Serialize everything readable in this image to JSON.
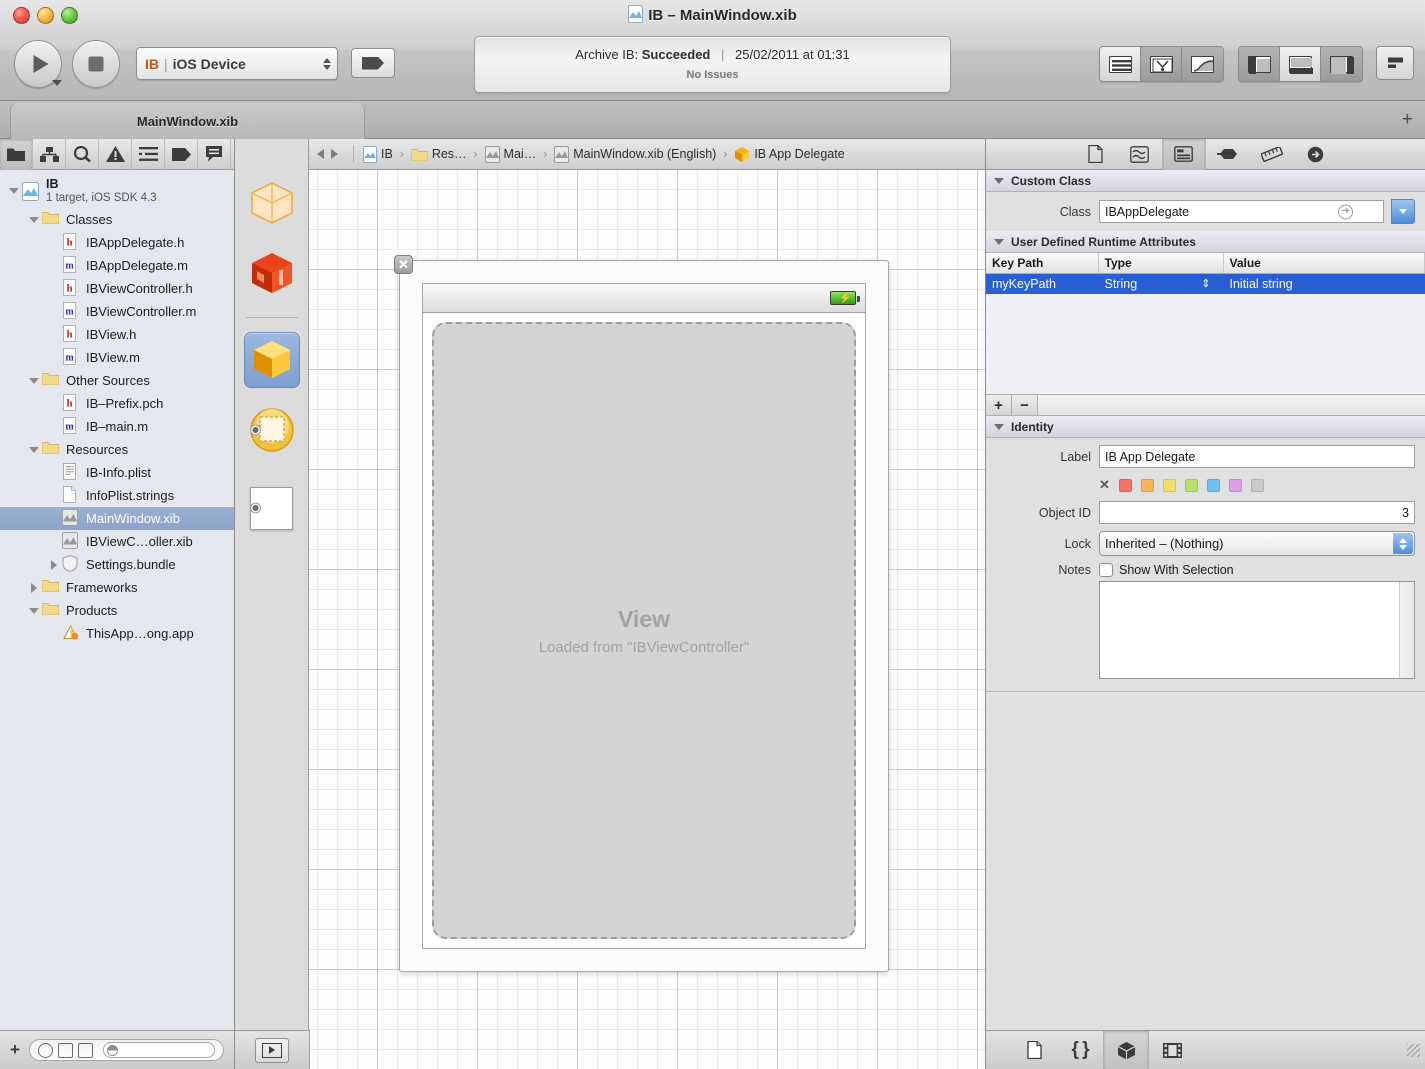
{
  "window": {
    "title": "IB – MainWindow.xib",
    "title_icon": "xib-file-icon",
    "controls": [
      "close",
      "minimize",
      "zoom"
    ]
  },
  "toolbar": {
    "run_button": "run-button",
    "stop_button": "stop-button",
    "scheme": {
      "scheme_name": "IB",
      "separator": "|",
      "destination": "iOS Device"
    },
    "breakpoints_button": "breakpoints-button",
    "status": {
      "line1_prefix": "Archive IB:",
      "line1_result": "Succeeded",
      "line1_divider": "|",
      "line1_date": "25/02/2011 at 01:31",
      "line2": "No Issues"
    },
    "editor_buttons": [
      "standard-editor",
      "assistant-editor",
      "version-editor"
    ],
    "view_buttons": [
      "hide-navigator",
      "hide-debug-area",
      "hide-utilities"
    ],
    "organizer_button": "organizer-button"
  },
  "tabbar": {
    "tab_label": "MainWindow.xib",
    "add_tab": "+"
  },
  "navigator": {
    "icons": [
      "project-navigator-icon",
      "symbol-navigator-icon",
      "search-navigator-icon",
      "issue-navigator-icon",
      "debug-navigator-icon",
      "breakpoint-navigator-icon",
      "log-navigator-icon"
    ],
    "tree": [
      {
        "label": "IB",
        "sublabel": "1 target, iOS SDK 4.3",
        "icon": "project-icon",
        "depth": 0,
        "disclosure": "open",
        "selected": false
      },
      {
        "label": "Classes",
        "icon": "folder-icon",
        "depth": 1,
        "disclosure": "open",
        "selected": false
      },
      {
        "label": "IBAppDelegate.h",
        "icon": "header-file-icon",
        "depth": 2,
        "disclosure": "none",
        "selected": false
      },
      {
        "label": "IBAppDelegate.m",
        "icon": "source-file-icon",
        "depth": 2,
        "disclosure": "none",
        "selected": false
      },
      {
        "label": "IBViewController.h",
        "icon": "header-file-icon",
        "depth": 2,
        "disclosure": "none",
        "selected": false
      },
      {
        "label": "IBViewController.m",
        "icon": "source-file-icon",
        "depth": 2,
        "disclosure": "none",
        "selected": false
      },
      {
        "label": "IBView.h",
        "icon": "header-file-icon",
        "depth": 2,
        "disclosure": "none",
        "selected": false
      },
      {
        "label": "IBView.m",
        "icon": "source-file-icon",
        "depth": 2,
        "disclosure": "none",
        "selected": false
      },
      {
        "label": "Other Sources",
        "icon": "folder-icon",
        "depth": 1,
        "disclosure": "open",
        "selected": false
      },
      {
        "label": "IB–Prefix.pch",
        "icon": "header-file-icon",
        "depth": 2,
        "disclosure": "none",
        "selected": false
      },
      {
        "label": "IB–main.m",
        "icon": "source-file-icon",
        "depth": 2,
        "disclosure": "none",
        "selected": false
      },
      {
        "label": "Resources",
        "icon": "folder-icon",
        "depth": 1,
        "disclosure": "open",
        "selected": false
      },
      {
        "label": "IB-Info.plist",
        "icon": "plist-file-icon",
        "depth": 2,
        "disclosure": "none",
        "selected": false
      },
      {
        "label": "InfoPlist.strings",
        "icon": "strings-file-icon",
        "depth": 2,
        "disclosure": "none",
        "selected": false
      },
      {
        "label": "MainWindow.xib",
        "icon": "xib-file-icon",
        "depth": 2,
        "disclosure": "none",
        "selected": true
      },
      {
        "label": "IBViewC…oller.xib",
        "icon": "xib-file-icon",
        "depth": 2,
        "disclosure": "none",
        "selected": false
      },
      {
        "label": "Settings.bundle",
        "icon": "bundle-icon",
        "depth": 2,
        "disclosure": "closed",
        "selected": false
      },
      {
        "label": "Frameworks",
        "icon": "folder-icon",
        "depth": 1,
        "disclosure": "closed",
        "selected": false
      },
      {
        "label": "Products",
        "icon": "folder-icon",
        "depth": 1,
        "disclosure": "open",
        "selected": false
      },
      {
        "label": "ThisApp…ong.app",
        "icon": "app-product-icon",
        "depth": 2,
        "disclosure": "none",
        "selected": false
      }
    ],
    "footer": {
      "add_button": "+",
      "filter_recent": "recent-filter-icon",
      "filter_unsaved": "unsaved-filter-icon",
      "filter_edited": "edited-filter-icon",
      "filter_placeholder": ""
    }
  },
  "dock": {
    "items": [
      {
        "name": "files-owner-placeholder",
        "kind": "cube-outline",
        "selected": false,
        "radio": false
      },
      {
        "name": "first-responder-placeholder",
        "kind": "cube-red",
        "selected": false,
        "radio": false
      },
      {
        "name": "ib-app-delegate-object",
        "kind": "cube-yellow",
        "selected": true,
        "radio": false
      },
      {
        "name": "ib-view-controller-object",
        "kind": "view-controller-round",
        "selected": false,
        "radio": true
      },
      {
        "name": "window-object",
        "kind": "window-white",
        "selected": false,
        "radio": true
      }
    ]
  },
  "editor": {
    "jump_bar": {
      "back": "back-arrow",
      "forward": "forward-arrow",
      "crumbs": [
        {
          "label": "IB",
          "icon": "project-icon"
        },
        {
          "label": "Res…",
          "icon": "folder-icon"
        },
        {
          "label": "Mai…",
          "icon": "xib-file-icon"
        },
        {
          "label": "MainWindow.xib (English)",
          "icon": "xib-file-icon"
        },
        {
          "label": "IB App Delegate",
          "icon": "cube-yellow-icon"
        }
      ]
    },
    "ios_window": {
      "close_badge": "✕",
      "status_bar_icon": "battery-charging-icon",
      "placeholder_title": "View",
      "placeholder_subtitle": "Loaded from \"IBViewController\""
    }
  },
  "inspector": {
    "tabs": [
      "file-inspector-icon",
      "quick-help-icon",
      "identity-inspector-icon",
      "attributes-inspector-icon",
      "size-inspector-icon",
      "connections-inspector-icon"
    ],
    "selected_tab": "identity-inspector-icon",
    "custom_class": {
      "section_title": "Custom Class",
      "class_label": "Class",
      "class_value": "IBAppDelegate"
    },
    "runtime_attributes": {
      "section_title": "User Defined Runtime Attributes",
      "columns": [
        "Key Path",
        "Type",
        "Value"
      ],
      "rows": [
        {
          "key_path": "myKeyPath",
          "type": "String",
          "value": "Initial string",
          "selected": true
        }
      ],
      "add_label": "+",
      "remove_label": "−"
    },
    "identity": {
      "section_title": "Identity",
      "label_label": "Label",
      "label_value": "IB App Delegate",
      "swatch_clear": "✕",
      "swatches": [
        "#f4736b",
        "#f5b45a",
        "#f2e168",
        "#b8e06a",
        "#6fc2f0",
        "#e39ce8",
        "#c9c9c9"
      ],
      "object_id_label": "Object ID",
      "object_id_value": "3",
      "lock_label": "Lock",
      "lock_value": "Inherited – (Nothing)",
      "notes_label": "Notes",
      "notes_checkbox_label": "Show With Selection",
      "notes_checked": false,
      "notes_value": ""
    },
    "footer_icons": [
      "file-template-library-icon",
      "code-snippet-library-icon",
      "object-library-icon",
      "media-library-icon"
    ],
    "footer_selected": "object-library-icon"
  },
  "colors": {
    "selection_blue": "#2a5fd4",
    "tree_selection": "#8ba3ca",
    "accent_orange": "#c2561d"
  }
}
